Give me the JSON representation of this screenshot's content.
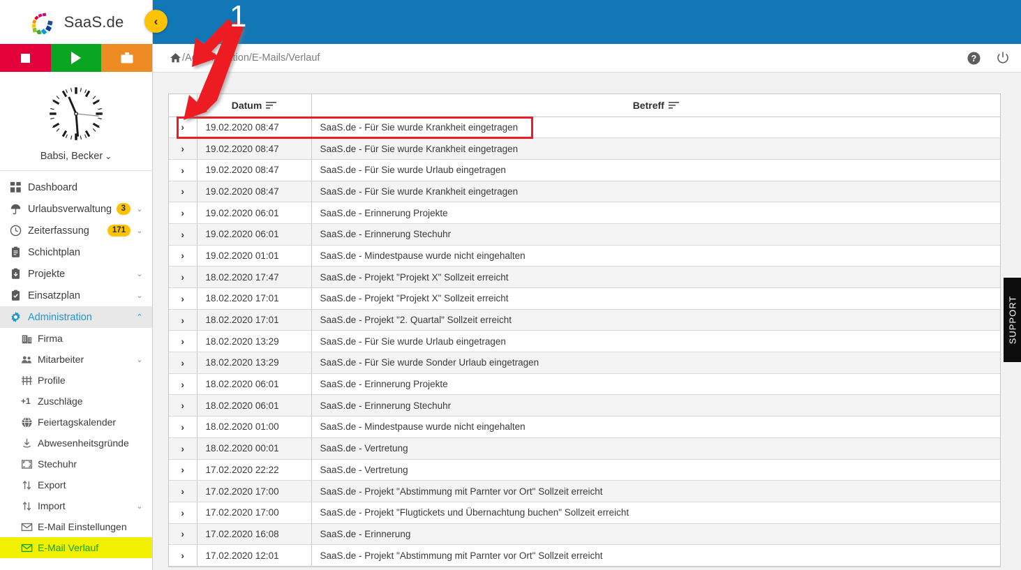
{
  "brand": {
    "name": "SaaS.de",
    "logo_icon": "saasde-logo"
  },
  "quick_actions": [
    {
      "name": "stop-button",
      "icon": "stop-icon",
      "color": "#e4003a"
    },
    {
      "name": "play-button",
      "icon": "play-icon",
      "color": "#0aa523"
    },
    {
      "name": "briefcase-button",
      "icon": "briefcase-icon",
      "color": "#ee8b22"
    }
  ],
  "user": {
    "name": "Babsi, Becker",
    "caret": "⌄",
    "clock_icon": "analog-clock-icon"
  },
  "collapse_button": {
    "icon": "chevron-left-icon",
    "color": "#fdc300"
  },
  "sidebar": {
    "items": [
      {
        "label": "Dashboard",
        "icon": "dashboard-grid-icon",
        "badge": "",
        "chevron": "",
        "level": 1,
        "state": ""
      },
      {
        "label": "Urlaubsverwaltung",
        "icon": "umbrella-icon",
        "badge": "3",
        "chevron": "⌄",
        "level": 1,
        "state": ""
      },
      {
        "label": "Zeiterfassung",
        "icon": "clock-icon",
        "badge": "171",
        "chevron": "⌄",
        "level": 1,
        "state": ""
      },
      {
        "label": "Schichtplan",
        "icon": "clipboard-icon",
        "badge": "",
        "chevron": "",
        "level": 1,
        "state": ""
      },
      {
        "label": "Projekte",
        "icon": "box-icon",
        "badge": "",
        "chevron": "⌄",
        "level": 1,
        "state": ""
      },
      {
        "label": "Einsatzplan",
        "icon": "checklist-icon",
        "badge": "",
        "chevron": "⌄",
        "level": 1,
        "state": ""
      },
      {
        "label": "Administration",
        "icon": "gear-icon",
        "badge": "",
        "chevron": "⌃",
        "level": 1,
        "state": "active"
      },
      {
        "label": "Firma",
        "icon": "building-icon",
        "badge": "",
        "chevron": "",
        "level": 2,
        "state": ""
      },
      {
        "label": "Mitarbeiter",
        "icon": "people-icon",
        "badge": "",
        "chevron": "⌄",
        "level": 2,
        "state": ""
      },
      {
        "label": "Profile",
        "icon": "sliders-icon",
        "badge": "",
        "chevron": "",
        "level": 2,
        "state": ""
      },
      {
        "label": "Zuschläge",
        "icon": "plus-one-icon",
        "badge": "",
        "chevron": "",
        "level": 2,
        "state": ""
      },
      {
        "label": "Feiertagskalender",
        "icon": "globe-icon",
        "badge": "",
        "chevron": "",
        "level": 2,
        "state": ""
      },
      {
        "label": "Abwesenheitsgründe",
        "icon": "download-icon",
        "badge": "",
        "chevron": "",
        "level": 2,
        "state": ""
      },
      {
        "label": "Stechuhr",
        "icon": "punch-clock-icon",
        "badge": "",
        "chevron": "",
        "level": 2,
        "state": ""
      },
      {
        "label": "Export",
        "icon": "export-arrows-icon",
        "badge": "",
        "chevron": "",
        "level": 2,
        "state": ""
      },
      {
        "label": "Import",
        "icon": "import-arrows-icon",
        "badge": "",
        "chevron": "⌄",
        "level": 2,
        "state": ""
      },
      {
        "label": "E-Mail Einstellungen",
        "icon": "envelope-icon",
        "badge": "",
        "chevron": "",
        "level": 2,
        "state": ""
      },
      {
        "label": "E-Mail Verlauf",
        "icon": "envelope-icon",
        "badge": "",
        "chevron": "",
        "level": 2,
        "state": "highlight"
      }
    ]
  },
  "breadcrumb": {
    "home_icon": "home-icon",
    "path": "/Administration/E-Mails/Verlauf"
  },
  "header_icons": [
    {
      "name": "help-icon",
      "glyph": "?"
    },
    {
      "name": "power-icon",
      "glyph": "⏻"
    }
  ],
  "table": {
    "columns": [
      {
        "label": "",
        "sort_icon": ""
      },
      {
        "label": "Datum",
        "sort_icon": "sort-icon"
      },
      {
        "label": "Betreff",
        "sort_icon": "sort-icon"
      }
    ],
    "expand_icon": "chevron-right-icon",
    "rows": [
      {
        "datum": "19.02.2020 08:47",
        "betreff": "SaaS.de - Für Sie wurde Krankheit eingetragen"
      },
      {
        "datum": "19.02.2020 08:47",
        "betreff": "SaaS.de - Für Sie wurde Krankheit eingetragen"
      },
      {
        "datum": "19.02.2020 08:47",
        "betreff": "SaaS.de - Für Sie wurde Urlaub eingetragen"
      },
      {
        "datum": "19.02.2020 08:47",
        "betreff": "SaaS.de - Für Sie wurde Krankheit eingetragen"
      },
      {
        "datum": "19.02.2020 06:01",
        "betreff": "SaaS.de - Erinnerung Projekte"
      },
      {
        "datum": "19.02.2020 06:01",
        "betreff": "SaaS.de - Erinnerung Stechuhr"
      },
      {
        "datum": "19.02.2020 01:01",
        "betreff": "SaaS.de - Mindestpause wurde nicht eingehalten"
      },
      {
        "datum": "18.02.2020 17:47",
        "betreff": "SaaS.de - Projekt \"Projekt X\" Sollzeit erreicht"
      },
      {
        "datum": "18.02.2020 17:01",
        "betreff": "SaaS.de - Projekt \"Projekt X\" Sollzeit erreicht"
      },
      {
        "datum": "18.02.2020 17:01",
        "betreff": "SaaS.de - Projekt \"2. Quartal\" Sollzeit erreicht"
      },
      {
        "datum": "18.02.2020 13:29",
        "betreff": "SaaS.de - Für Sie wurde Urlaub eingetragen"
      },
      {
        "datum": "18.02.2020 13:29",
        "betreff": "SaaS.de - Für Sie wurde Sonder Urlaub eingetragen"
      },
      {
        "datum": "18.02.2020 06:01",
        "betreff": "SaaS.de - Erinnerung Projekte"
      },
      {
        "datum": "18.02.2020 06:01",
        "betreff": "SaaS.de - Erinnerung Stechuhr"
      },
      {
        "datum": "18.02.2020 01:00",
        "betreff": "SaaS.de - Mindestpause wurde nicht eingehalten"
      },
      {
        "datum": "18.02.2020 00:01",
        "betreff": "SaaS.de - Vertretung"
      },
      {
        "datum": "17.02.2020 22:22",
        "betreff": "SaaS.de - Vertretung"
      },
      {
        "datum": "17.02.2020 17:00",
        "betreff": "SaaS.de - Projekt \"Abstimmung mit Parnter vor Ort\" Sollzeit erreicht"
      },
      {
        "datum": "17.02.2020 17:00",
        "betreff": "SaaS.de - Projekt \"Flugtickets und Übernachtung buchen\" Sollzeit erreicht"
      },
      {
        "datum": "17.02.2020 16:08",
        "betreff": "SaaS.de - Erinnerung"
      },
      {
        "datum": "17.02.2020 12:01",
        "betreff": "SaaS.de - Projekt \"Abstimmung mit Parnter vor Ort\" Sollzeit erreicht"
      }
    ]
  },
  "annotation": {
    "number": "1",
    "color": "#ed1c24"
  },
  "support_tab": {
    "label": "SUPPORT"
  },
  "colors": {
    "header_blue": "#1177b5",
    "accent_yellow": "#fdc300",
    "highlight_yellow": "#f1f000",
    "highlight_green": "#0aa523",
    "annotation_red": "#ed1c24",
    "active_blue": "#2196d6"
  }
}
